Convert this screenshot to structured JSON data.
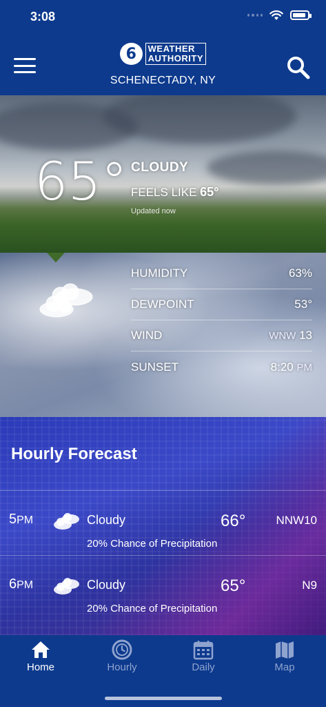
{
  "status_bar": {
    "time": "3:08",
    "battery_level": 0.9
  },
  "header": {
    "logo_number": "6",
    "logo_text_line1": "WEATHER",
    "logo_text_line2": "AUTHORITY",
    "location": "SCHENECTADY, NY",
    "menu_icon": "hamburger-icon",
    "search_icon": "search-icon"
  },
  "current": {
    "temperature": "65°",
    "condition": "CLOUDY",
    "feels_like_label": "FEELS LIKE",
    "feels_like_value": "65°",
    "updated": "Updated now"
  },
  "details": {
    "rows": [
      {
        "label": "HUMIDITY",
        "value": "63%"
      },
      {
        "label": "DEWPOINT",
        "value": "53°"
      },
      {
        "label": "WIND",
        "value_prefix": "WNW",
        "value": "13"
      },
      {
        "label": "SUNSET",
        "value": "8:20",
        "value_suffix": "PM"
      }
    ]
  },
  "hourly": {
    "title": "Hourly Forecast",
    "rows": [
      {
        "hour": "5",
        "period": "PM",
        "condition": "Cloudy",
        "temp": "66°",
        "wind": "NNW10",
        "precip": "20% Chance of Precipitation"
      },
      {
        "hour": "6",
        "period": "PM",
        "condition": "Cloudy",
        "temp": "65°",
        "wind": "N9",
        "precip": "20% Chance of Precipitation"
      }
    ]
  },
  "nav": {
    "items": [
      {
        "label": "Home",
        "icon": "home-icon",
        "active": true
      },
      {
        "label": "Hourly",
        "icon": "clock-icon",
        "active": false
      },
      {
        "label": "Daily",
        "icon": "calendar-icon",
        "active": false
      },
      {
        "label": "Map",
        "icon": "map-icon",
        "active": false
      }
    ]
  },
  "colors": {
    "primary": "#0d3a8d",
    "inactive_nav": "#8fa3cf"
  }
}
